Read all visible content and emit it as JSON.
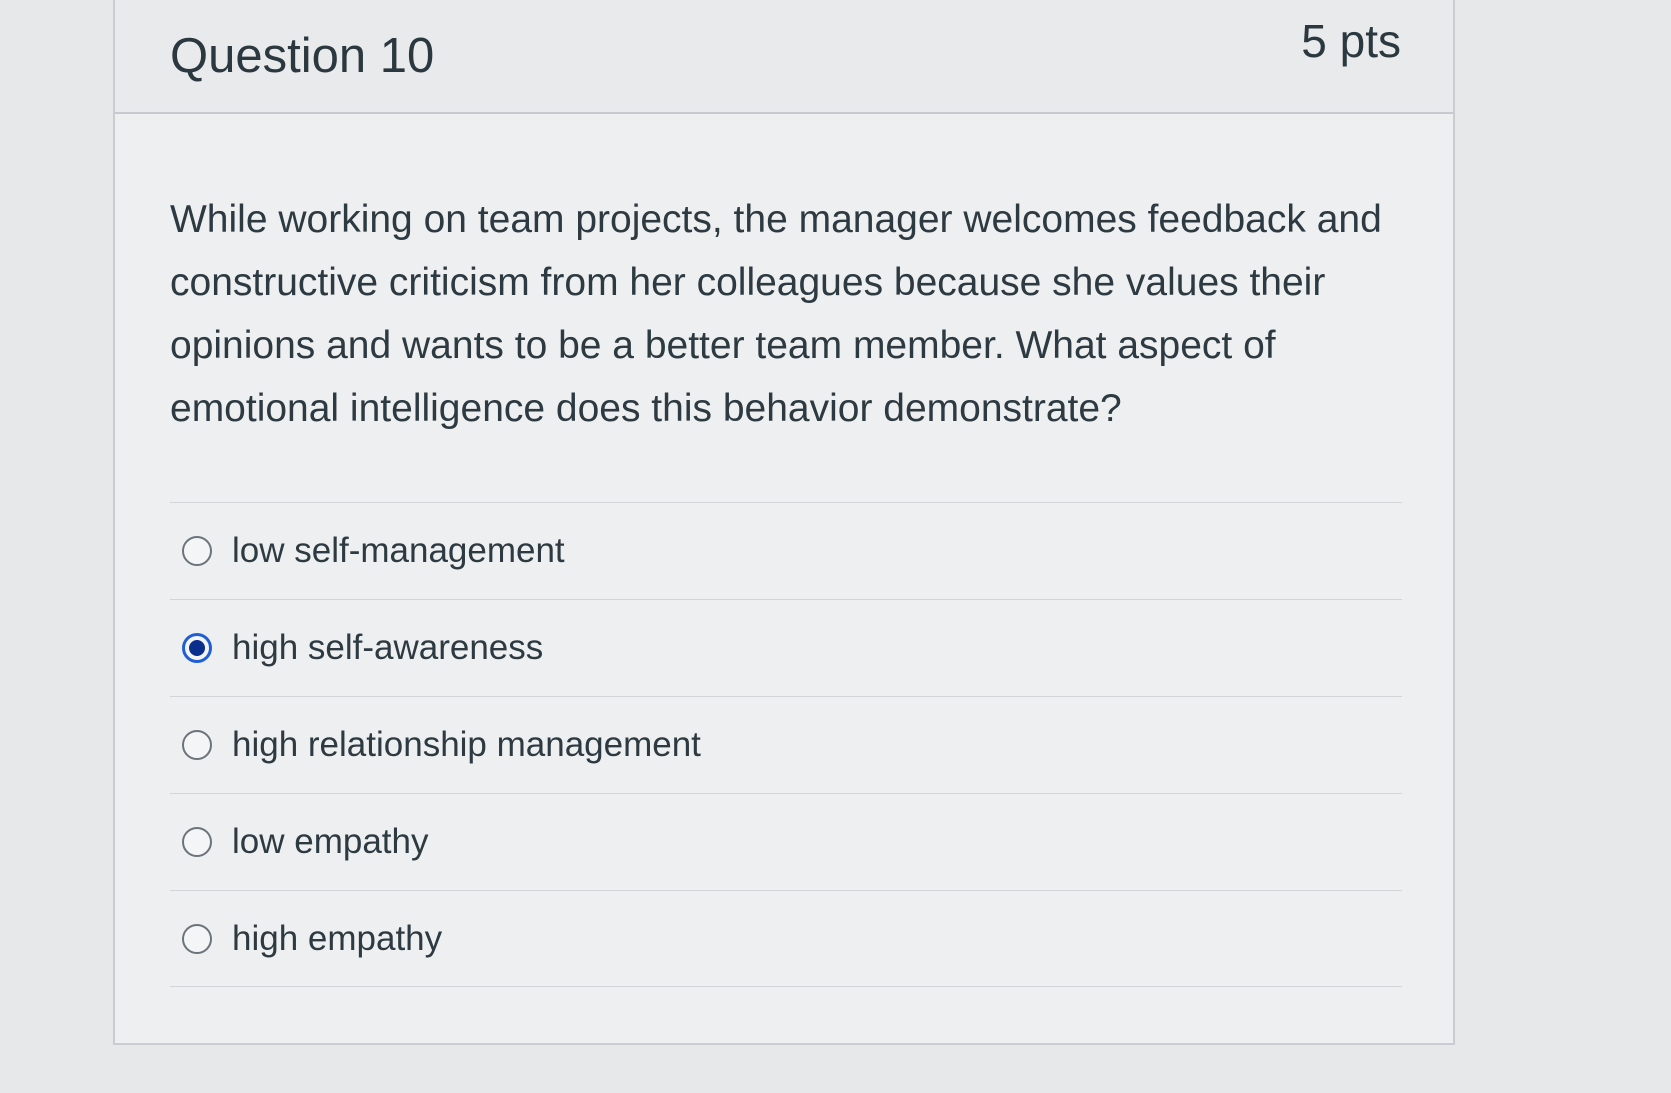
{
  "question": {
    "title": "Question 10",
    "points": "5 pts",
    "text": "While working on team projects, the manager welcomes feedback and constructive criticism from her colleagues because she values their opinions and wants to be a better team member. What aspect of emotional intelligence does this behavior demonstrate?",
    "answers": [
      {
        "label": "low self-management",
        "selected": false
      },
      {
        "label": "high self-awareness",
        "selected": true
      },
      {
        "label": "high relationship management",
        "selected": false
      },
      {
        "label": "low empathy",
        "selected": false
      },
      {
        "label": "high empathy",
        "selected": false
      }
    ]
  },
  "colors": {
    "selected_radio": "#1f5fd6",
    "text": "#2d3a42"
  }
}
